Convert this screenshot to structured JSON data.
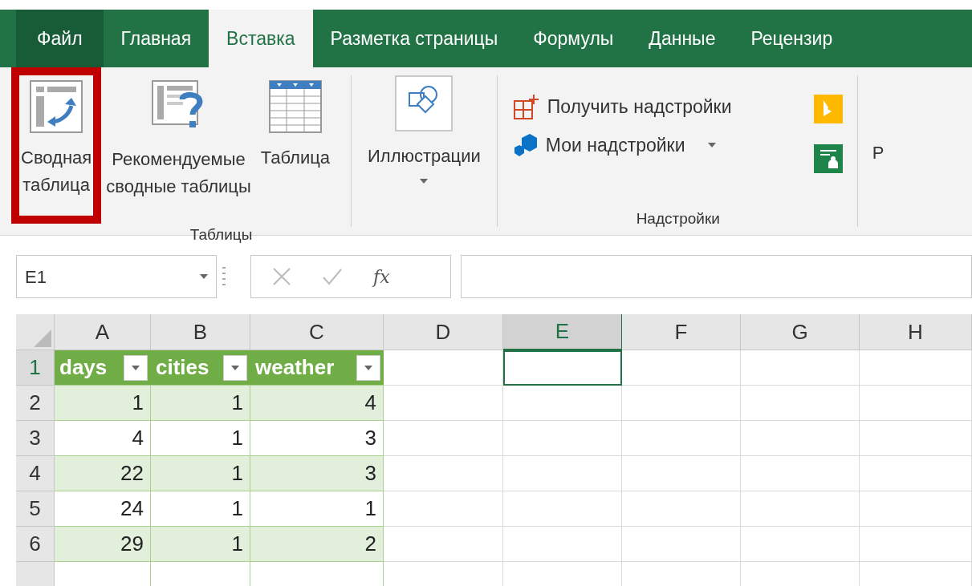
{
  "tabs": [
    {
      "label": "Файл",
      "kind": "file",
      "selected": false
    },
    {
      "label": "Главная",
      "kind": "tab",
      "selected": false
    },
    {
      "label": "Вставка",
      "kind": "tab",
      "selected": true
    },
    {
      "label": "Разметка страницы",
      "kind": "tab",
      "selected": false
    },
    {
      "label": "Формулы",
      "kind": "tab",
      "selected": false
    },
    {
      "label": "Данные",
      "kind": "tab",
      "selected": false
    },
    {
      "label": "Рецензир",
      "kind": "tab",
      "selected": false
    }
  ],
  "ribbon": {
    "tables_group": {
      "label": "Таблицы",
      "buttons": [
        {
          "lines": [
            "Сводная",
            "таблица"
          ],
          "kind": "pivot",
          "highlighted": true
        },
        {
          "lines": [
            "Рекомендуемые",
            "сводные таблицы"
          ],
          "kind": "recommended",
          "highlighted": false
        },
        {
          "lines": [
            "Таблица"
          ],
          "kind": "table",
          "highlighted": false
        }
      ]
    },
    "illustrations": {
      "label": "Иллюстрации",
      "dropdown": true
    },
    "addins_group": {
      "label": "Надстройки",
      "items": [
        {
          "label": "Получить надстройки",
          "kind": "store",
          "dropdown": false
        },
        {
          "label": "Мои надстройки",
          "kind": "my",
          "dropdown": true
        }
      ]
    },
    "group_4": {
      "label": "Р"
    }
  },
  "formula_bar": {
    "name_box": "E1",
    "function_label": "fx"
  },
  "grid": {
    "columns": [
      {
        "label": "A",
        "selected": false
      },
      {
        "label": "B",
        "selected": false
      },
      {
        "label": "C",
        "selected": false
      },
      {
        "label": "D",
        "selected": false
      },
      {
        "label": "E",
        "selected": true
      },
      {
        "label": "F",
        "selected": false
      },
      {
        "label": "G",
        "selected": false
      },
      {
        "label": "H",
        "selected": false
      }
    ],
    "table_headers": [
      "days",
      "cities",
      "weather"
    ],
    "rows": [
      {
        "number": "1",
        "selected": true
      },
      {
        "number": "2",
        "cells": [
          "1",
          "1",
          "4"
        ],
        "selected": false
      },
      {
        "number": "3",
        "cells": [
          "4",
          "1",
          "3"
        ],
        "selected": false
      },
      {
        "number": "4",
        "cells": [
          "22",
          "1",
          "3"
        ],
        "selected": false
      },
      {
        "number": "5",
        "cells": [
          "24",
          "1",
          "1"
        ],
        "selected": false
      },
      {
        "number": "6",
        "cells": [
          "29",
          "1",
          "2"
        ],
        "selected": false
      }
    ]
  }
}
